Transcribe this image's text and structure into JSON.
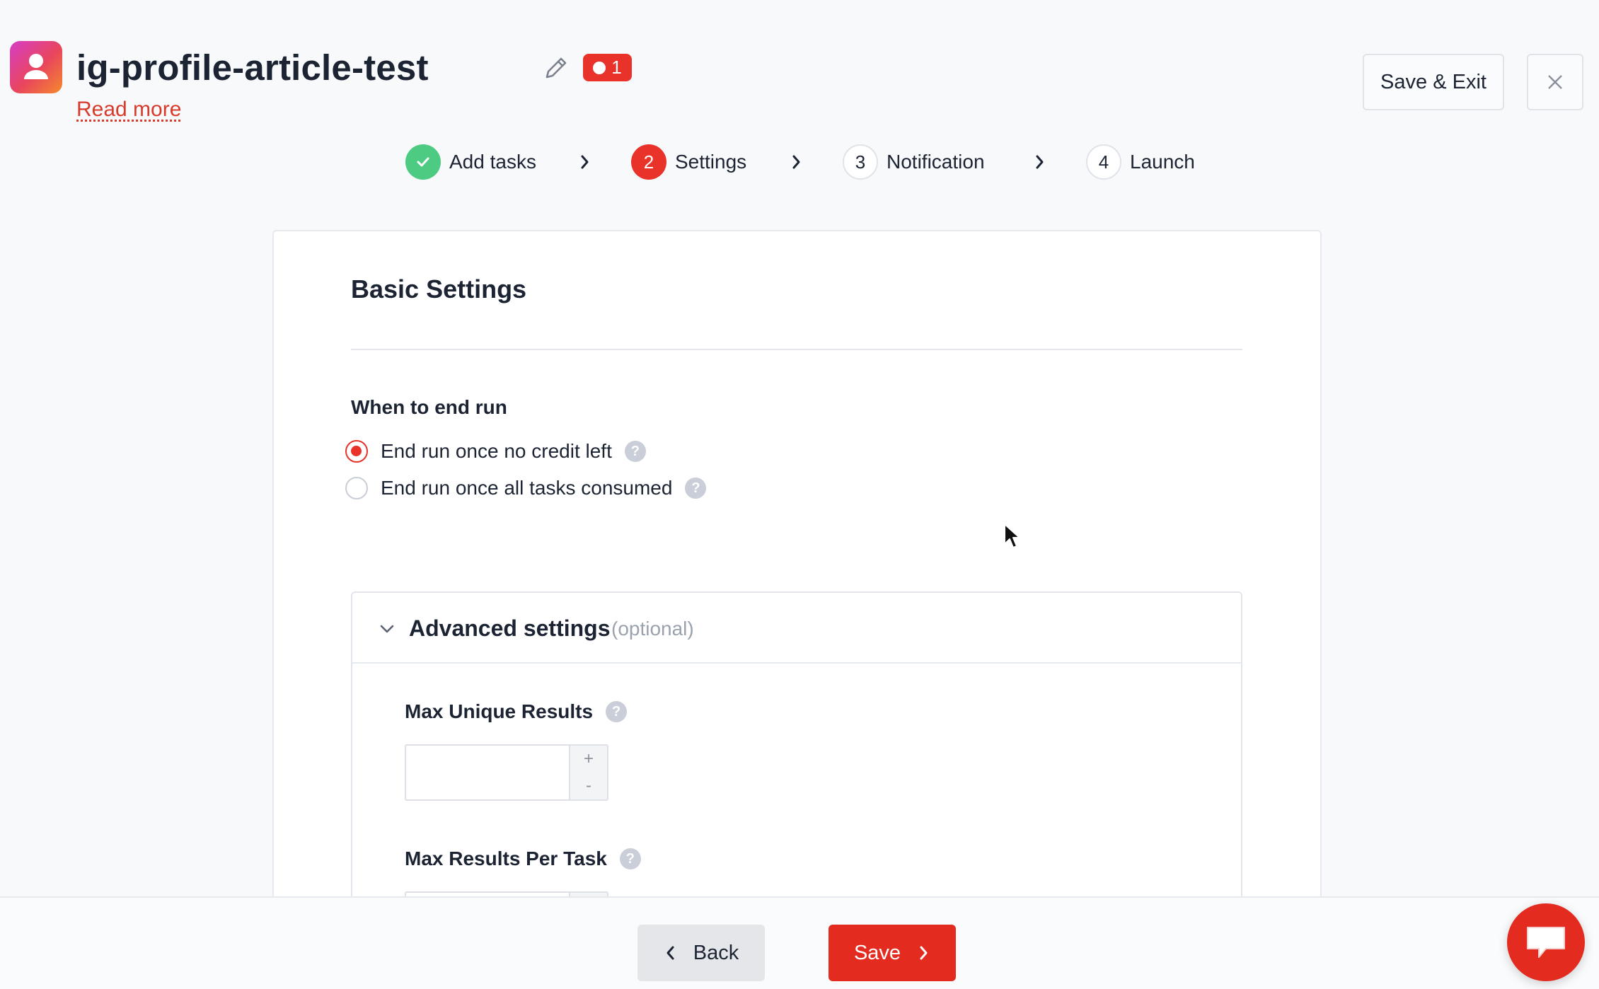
{
  "header": {
    "title": "ig-profile-article-test",
    "read_more": "Read more",
    "badge_count": "1",
    "save_exit_label": "Save & Exit",
    "icons": {
      "app": "instagram-profile-icon",
      "edit": "pencil-icon",
      "close": "close-icon",
      "badge": "toggle-icon"
    }
  },
  "stepper": {
    "steps": [
      {
        "number": "",
        "label": "Add tasks",
        "state": "done"
      },
      {
        "number": "2",
        "label": "Settings",
        "state": "active"
      },
      {
        "number": "3",
        "label": "Notification",
        "state": "todo"
      },
      {
        "number": "4",
        "label": "Launch",
        "state": "todo"
      }
    ]
  },
  "basic": {
    "title": "Basic Settings",
    "end_run_label": "When to end run",
    "options": [
      {
        "label": "End run once no credit left",
        "checked": true,
        "help": "?"
      },
      {
        "label": "End run once all tasks consumed",
        "checked": false,
        "help": "?"
      }
    ]
  },
  "advanced": {
    "title": "Advanced settings",
    "optional": "(optional)",
    "expanded": true,
    "fields": [
      {
        "label": "Max Unique Results",
        "value": "",
        "help": "?",
        "plus": "+",
        "minus": "-"
      },
      {
        "label": "Max Results Per Task",
        "value": "",
        "help": "?"
      }
    ]
  },
  "footer": {
    "back_label": "Back",
    "save_label": "Save"
  },
  "colors": {
    "accent": "#e8322a",
    "success": "#4ecb82",
    "text": "#1c2433",
    "link": "#d83a2c"
  }
}
